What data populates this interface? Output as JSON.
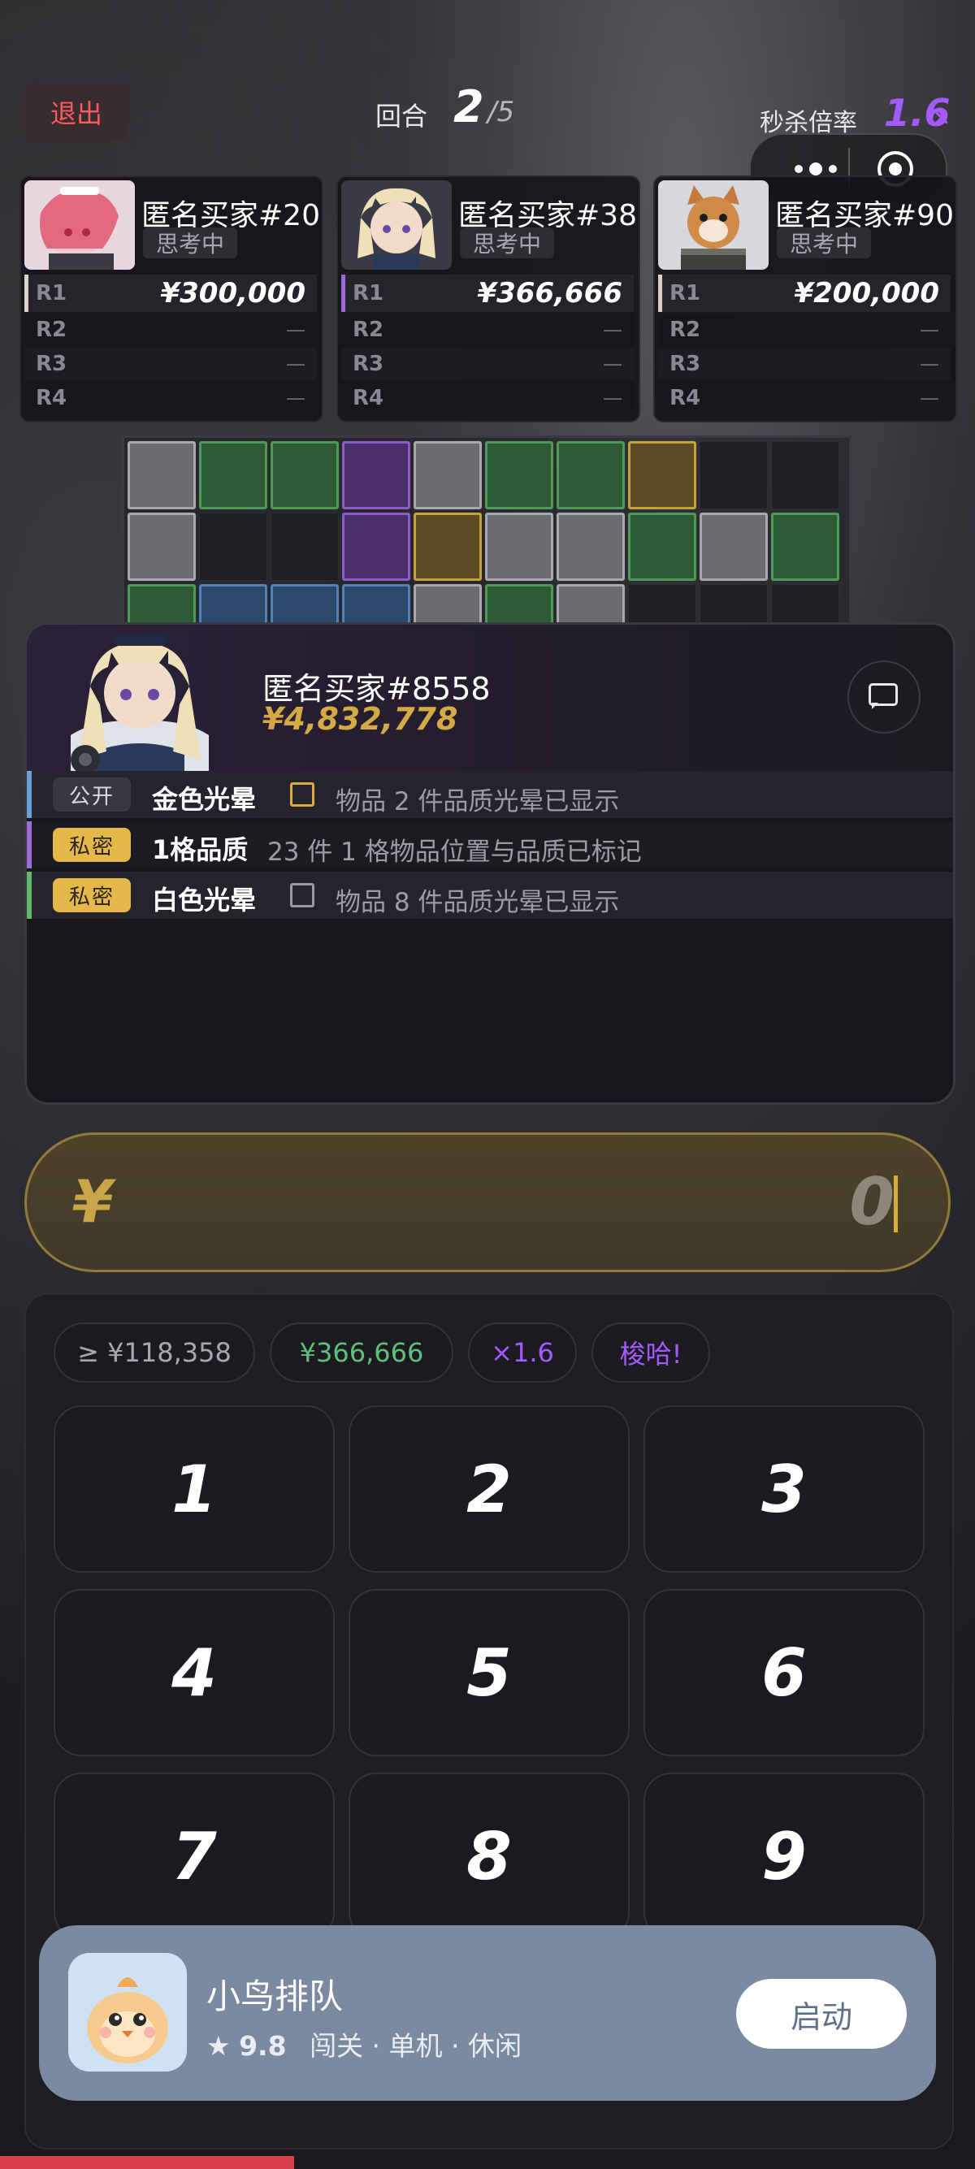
{
  "header": {
    "exit_label": "退出",
    "round_label": "回合",
    "round_current": "2",
    "round_total": "/5",
    "multiplier_label": "秒杀倍率",
    "multiplier_value": "1.6",
    "multiplier_suffix": "×"
  },
  "players": [
    {
      "name": "匿名买家#20",
      "status": "思考中",
      "accent": "#d9d3c6",
      "rounds": [
        {
          "label": "R1",
          "value": "¥300,000"
        },
        {
          "label": "R2",
          "value": "—"
        },
        {
          "label": "R3",
          "value": "—"
        },
        {
          "label": "R4",
          "value": "—"
        }
      ]
    },
    {
      "name": "匿名买家#38",
      "status": "思考中",
      "accent": "#9b6bd8",
      "rounds": [
        {
          "label": "R1",
          "value": "¥366,666"
        },
        {
          "label": "R2",
          "value": "—"
        },
        {
          "label": "R3",
          "value": "—"
        },
        {
          "label": "R4",
          "value": "—"
        }
      ]
    },
    {
      "name": "匿名买家#90",
      "status": "思考中",
      "accent": "#d9d3c6",
      "rounds": [
        {
          "label": "R1",
          "value": "¥200,000"
        },
        {
          "label": "R2",
          "value": "—"
        },
        {
          "label": "R3",
          "value": "—"
        },
        {
          "label": "R4",
          "value": "—"
        }
      ]
    }
  ],
  "grid_colors": {
    "gray": "#a9a8ae",
    "green": "#4d9a57",
    "purple": "#8a5cc9",
    "gold": "#c5a13b",
    "blue": "#4f82b8"
  },
  "me": {
    "name": "匿名买家#8558",
    "money": "¥4,832,778"
  },
  "info_rows": [
    {
      "tag": "公开",
      "title": "金色光晕",
      "desc": "物品 2 件品质光晕已显示"
    },
    {
      "tag": "私密",
      "title": "1格品质",
      "desc": "23 件 1 格物品位置与品质已标记"
    },
    {
      "tag": "私密",
      "title": "白色光晕",
      "desc": "物品 8 件品质光晕已显示"
    }
  ],
  "bid_input": {
    "currency": "¥",
    "value": "0"
  },
  "chips": [
    "≥ ¥118,358",
    "¥366,666",
    "×1.6",
    "梭哈!"
  ],
  "keys": [
    "1",
    "2",
    "3",
    "4",
    "5",
    "6",
    "7",
    "8",
    "9"
  ],
  "ad": {
    "title": "小鸟排队",
    "rating": "9.8",
    "tags": "闯关 · 单机 · 休闲",
    "button": "启动"
  }
}
